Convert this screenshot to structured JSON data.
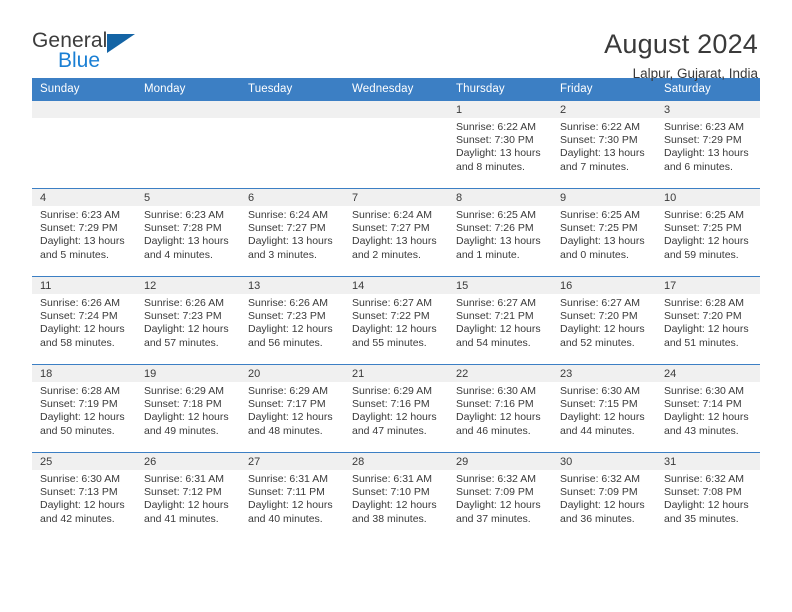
{
  "brand": {
    "name_top": "General",
    "name_bottom": "Blue",
    "accent_color": "#1a7fd4",
    "triangle_color": "#1464a5"
  },
  "header": {
    "title": "August 2024",
    "subtitle": "Lalpur, Gujarat, India"
  },
  "calendar": {
    "header_bg": "#3c7fc4",
    "daynum_band_bg": "#f0f0f0",
    "weekdays": [
      "Sunday",
      "Monday",
      "Tuesday",
      "Wednesday",
      "Thursday",
      "Friday",
      "Saturday"
    ],
    "weeks": [
      [
        {
          "day": "",
          "sunrise": "",
          "sunset": "",
          "daylight": "",
          "empty": true
        },
        {
          "day": "",
          "sunrise": "",
          "sunset": "",
          "daylight": "",
          "empty": true
        },
        {
          "day": "",
          "sunrise": "",
          "sunset": "",
          "daylight": "",
          "empty": true
        },
        {
          "day": "",
          "sunrise": "",
          "sunset": "",
          "daylight": "",
          "empty": true
        },
        {
          "day": "1",
          "sunrise": "Sunrise: 6:22 AM",
          "sunset": "Sunset: 7:30 PM",
          "daylight": "Daylight: 13 hours and 8 minutes."
        },
        {
          "day": "2",
          "sunrise": "Sunrise: 6:22 AM",
          "sunset": "Sunset: 7:30 PM",
          "daylight": "Daylight: 13 hours and 7 minutes."
        },
        {
          "day": "3",
          "sunrise": "Sunrise: 6:23 AM",
          "sunset": "Sunset: 7:29 PM",
          "daylight": "Daylight: 13 hours and 6 minutes."
        }
      ],
      [
        {
          "day": "4",
          "sunrise": "Sunrise: 6:23 AM",
          "sunset": "Sunset: 7:29 PM",
          "daylight": "Daylight: 13 hours and 5 minutes."
        },
        {
          "day": "5",
          "sunrise": "Sunrise: 6:23 AM",
          "sunset": "Sunset: 7:28 PM",
          "daylight": "Daylight: 13 hours and 4 minutes."
        },
        {
          "day": "6",
          "sunrise": "Sunrise: 6:24 AM",
          "sunset": "Sunset: 7:27 PM",
          "daylight": "Daylight: 13 hours and 3 minutes."
        },
        {
          "day": "7",
          "sunrise": "Sunrise: 6:24 AM",
          "sunset": "Sunset: 7:27 PM",
          "daylight": "Daylight: 13 hours and 2 minutes."
        },
        {
          "day": "8",
          "sunrise": "Sunrise: 6:25 AM",
          "sunset": "Sunset: 7:26 PM",
          "daylight": "Daylight: 13 hours and 1 minute."
        },
        {
          "day": "9",
          "sunrise": "Sunrise: 6:25 AM",
          "sunset": "Sunset: 7:25 PM",
          "daylight": "Daylight: 13 hours and 0 minutes."
        },
        {
          "day": "10",
          "sunrise": "Sunrise: 6:25 AM",
          "sunset": "Sunset: 7:25 PM",
          "daylight": "Daylight: 12 hours and 59 minutes."
        }
      ],
      [
        {
          "day": "11",
          "sunrise": "Sunrise: 6:26 AM",
          "sunset": "Sunset: 7:24 PM",
          "daylight": "Daylight: 12 hours and 58 minutes."
        },
        {
          "day": "12",
          "sunrise": "Sunrise: 6:26 AM",
          "sunset": "Sunset: 7:23 PM",
          "daylight": "Daylight: 12 hours and 57 minutes."
        },
        {
          "day": "13",
          "sunrise": "Sunrise: 6:26 AM",
          "sunset": "Sunset: 7:23 PM",
          "daylight": "Daylight: 12 hours and 56 minutes."
        },
        {
          "day": "14",
          "sunrise": "Sunrise: 6:27 AM",
          "sunset": "Sunset: 7:22 PM",
          "daylight": "Daylight: 12 hours and 55 minutes."
        },
        {
          "day": "15",
          "sunrise": "Sunrise: 6:27 AM",
          "sunset": "Sunset: 7:21 PM",
          "daylight": "Daylight: 12 hours and 54 minutes."
        },
        {
          "day": "16",
          "sunrise": "Sunrise: 6:27 AM",
          "sunset": "Sunset: 7:20 PM",
          "daylight": "Daylight: 12 hours and 52 minutes."
        },
        {
          "day": "17",
          "sunrise": "Sunrise: 6:28 AM",
          "sunset": "Sunset: 7:20 PM",
          "daylight": "Daylight: 12 hours and 51 minutes."
        }
      ],
      [
        {
          "day": "18",
          "sunrise": "Sunrise: 6:28 AM",
          "sunset": "Sunset: 7:19 PM",
          "daylight": "Daylight: 12 hours and 50 minutes."
        },
        {
          "day": "19",
          "sunrise": "Sunrise: 6:29 AM",
          "sunset": "Sunset: 7:18 PM",
          "daylight": "Daylight: 12 hours and 49 minutes."
        },
        {
          "day": "20",
          "sunrise": "Sunrise: 6:29 AM",
          "sunset": "Sunset: 7:17 PM",
          "daylight": "Daylight: 12 hours and 48 minutes."
        },
        {
          "day": "21",
          "sunrise": "Sunrise: 6:29 AM",
          "sunset": "Sunset: 7:16 PM",
          "daylight": "Daylight: 12 hours and 47 minutes."
        },
        {
          "day": "22",
          "sunrise": "Sunrise: 6:30 AM",
          "sunset": "Sunset: 7:16 PM",
          "daylight": "Daylight: 12 hours and 46 minutes."
        },
        {
          "day": "23",
          "sunrise": "Sunrise: 6:30 AM",
          "sunset": "Sunset: 7:15 PM",
          "daylight": "Daylight: 12 hours and 44 minutes."
        },
        {
          "day": "24",
          "sunrise": "Sunrise: 6:30 AM",
          "sunset": "Sunset: 7:14 PM",
          "daylight": "Daylight: 12 hours and 43 minutes."
        }
      ],
      [
        {
          "day": "25",
          "sunrise": "Sunrise: 6:30 AM",
          "sunset": "Sunset: 7:13 PM",
          "daylight": "Daylight: 12 hours and 42 minutes."
        },
        {
          "day": "26",
          "sunrise": "Sunrise: 6:31 AM",
          "sunset": "Sunset: 7:12 PM",
          "daylight": "Daylight: 12 hours and 41 minutes."
        },
        {
          "day": "27",
          "sunrise": "Sunrise: 6:31 AM",
          "sunset": "Sunset: 7:11 PM",
          "daylight": "Daylight: 12 hours and 40 minutes."
        },
        {
          "day": "28",
          "sunrise": "Sunrise: 6:31 AM",
          "sunset": "Sunset: 7:10 PM",
          "daylight": "Daylight: 12 hours and 38 minutes."
        },
        {
          "day": "29",
          "sunrise": "Sunrise: 6:32 AM",
          "sunset": "Sunset: 7:09 PM",
          "daylight": "Daylight: 12 hours and 37 minutes."
        },
        {
          "day": "30",
          "sunrise": "Sunrise: 6:32 AM",
          "sunset": "Sunset: 7:09 PM",
          "daylight": "Daylight: 12 hours and 36 minutes."
        },
        {
          "day": "31",
          "sunrise": "Sunrise: 6:32 AM",
          "sunset": "Sunset: 7:08 PM",
          "daylight": "Daylight: 12 hours and 35 minutes."
        }
      ]
    ]
  }
}
